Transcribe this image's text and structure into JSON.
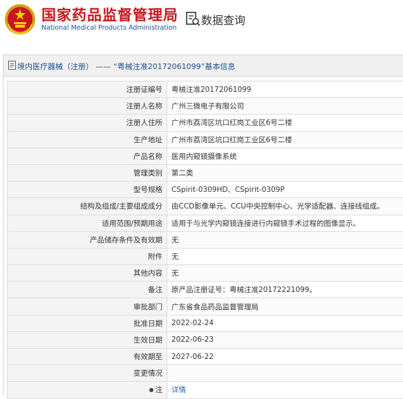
{
  "header": {
    "org_name_cn": "国家药品监督管理局",
    "org_name_en": "National Medical Products Administration",
    "page_label": "数据查询"
  },
  "panel": {
    "title": "境内医疗器械（注册） —— “粤械注准20172061099”基本信息"
  },
  "rows": [
    {
      "label": "注册证编号",
      "value": "粤械注准20172061099"
    },
    {
      "label": "注册人名称",
      "value": "广州三微电子有限公司"
    },
    {
      "label": "注册人住所",
      "value": "广州市荔湾区坑口红岗工业区6号二楼"
    },
    {
      "label": "生产地址",
      "value": "广州市荔湾区坑口红岗工业区6号二楼"
    },
    {
      "label": "产品名称",
      "value": "医用内窥镜摄像系统"
    },
    {
      "label": "管理类别",
      "value": "第二类"
    },
    {
      "label": "型号规格",
      "value": "CSpirit-0309HD、CSpirit-0309P"
    },
    {
      "label": "结构及组成/主要组成成分",
      "value": "由CCD影像单元、CCU中央控制中心、光学适配器、连接线组成。"
    },
    {
      "label": "适用范围/预期用途",
      "value": "适用于与光学内窥镜连接进行内窥镜手术过程的图像显示。"
    },
    {
      "label": "产品储存条件及有效期",
      "value": "无"
    },
    {
      "label": "附件",
      "value": "无"
    },
    {
      "label": "其他内容",
      "value": "无"
    },
    {
      "label": "备注",
      "value": "原产品注册证号：粤械注准20172221099。"
    },
    {
      "label": "审批部门",
      "value": "广东省食品药品监督管理局"
    },
    {
      "label": "批准日期",
      "value": "2022-02-24"
    },
    {
      "label": "生效日期",
      "value": "2022-06-23"
    },
    {
      "label": "有效期至",
      "value": "2027-06-22"
    },
    {
      "label": "变更情况",
      "value": ""
    },
    {
      "label": "注",
      "value": "详情"
    }
  ],
  "colors": {
    "brand_red": "#c8161d",
    "brand_blue": "#1c4f9c",
    "link_blue": "#2f67b0"
  },
  "icons": [
    "national-emblem-icon",
    "search-document-icon",
    "document-icon",
    "pin-icon"
  ]
}
